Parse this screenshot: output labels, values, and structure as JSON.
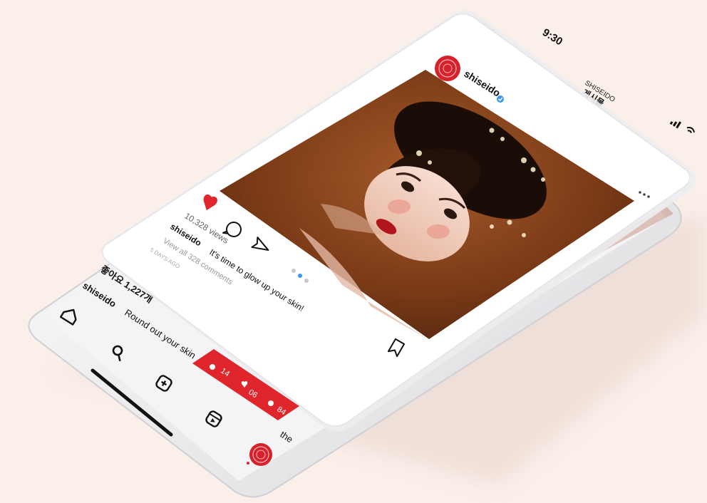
{
  "status_bar": {
    "time": "9:30",
    "signal_icon": "signal-bars-icon",
    "wifi_icon": "wifi-icon"
  },
  "header": {
    "back_icon": "chevron-left-icon",
    "brand": "SHISEIDO",
    "title": "게시물"
  },
  "post": {
    "username": "shiseido",
    "verified_icon": "verified-badge-icon",
    "more_icon": "more-dots-icon",
    "views": "10,328 views",
    "caption_user": "shiseido",
    "caption_text": "It's time to glow up your skin!",
    "view_comments": "View all 328 comments",
    "time_ago": "5 DAYS AGO",
    "like_icon": "heart-filled-icon",
    "comment_icon": "comment-icon",
    "share_icon": "send-icon",
    "save_icon": "bookmark-icon",
    "carousel_dots": 2,
    "carousel_active": 1
  },
  "back_post": {
    "likes": "좋아요 1,227개",
    "caption_user": "shiseido",
    "caption_text_1": "Round out your skin",
    "caption_text_2": "the"
  },
  "notification_badge": {
    "followers": "14",
    "likes": "06",
    "comments": "84",
    "color": "#e0262c"
  },
  "bottom_nav": {
    "home_icon": "home-icon",
    "search_icon": "search-icon",
    "add_icon": "add-post-icon",
    "reels_icon": "reels-icon",
    "profile_icon": "profile-avatar-icon"
  },
  "colors": {
    "accent": "#e0262c",
    "verified": "#3897f0",
    "background": "#fbefe9"
  }
}
